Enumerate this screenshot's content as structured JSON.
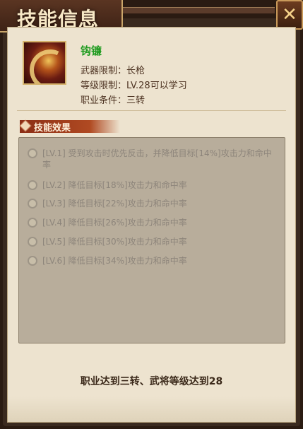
{
  "header": {
    "title": "技能信息"
  },
  "skill": {
    "name": "钩镰",
    "weapon_restriction": "武器限制：长枪",
    "level_restriction": "等级限制：LV.28可以学习",
    "job_condition": "职业条件：三转"
  },
  "effects_section": {
    "title": "技能效果",
    "levels": [
      {
        "label": "[LV.1]  受到攻击时优先反击，并降低目标[14%]攻击力和命中率"
      },
      {
        "label": "[LV.2]  降低目标[18%]攻击力和命中率"
      },
      {
        "label": "[LV.3]  降低目标[22%]攻击力和命中率"
      },
      {
        "label": "[LV.4]  降低目标[26%]攻击力和命中率"
      },
      {
        "label": "[LV.5]  降低目标[30%]攻击力和命中率"
      },
      {
        "label": "[LV.6]  降低目标[34%]攻击力和命中率"
      }
    ]
  },
  "requirement_note": "职业达到三转、武将等级达到28",
  "icons": {
    "close": "close-x-icon",
    "skill": "hook-sickle-skill-icon",
    "effect_bullet": "swirl-icon",
    "section_marker": "diamond-icon"
  }
}
